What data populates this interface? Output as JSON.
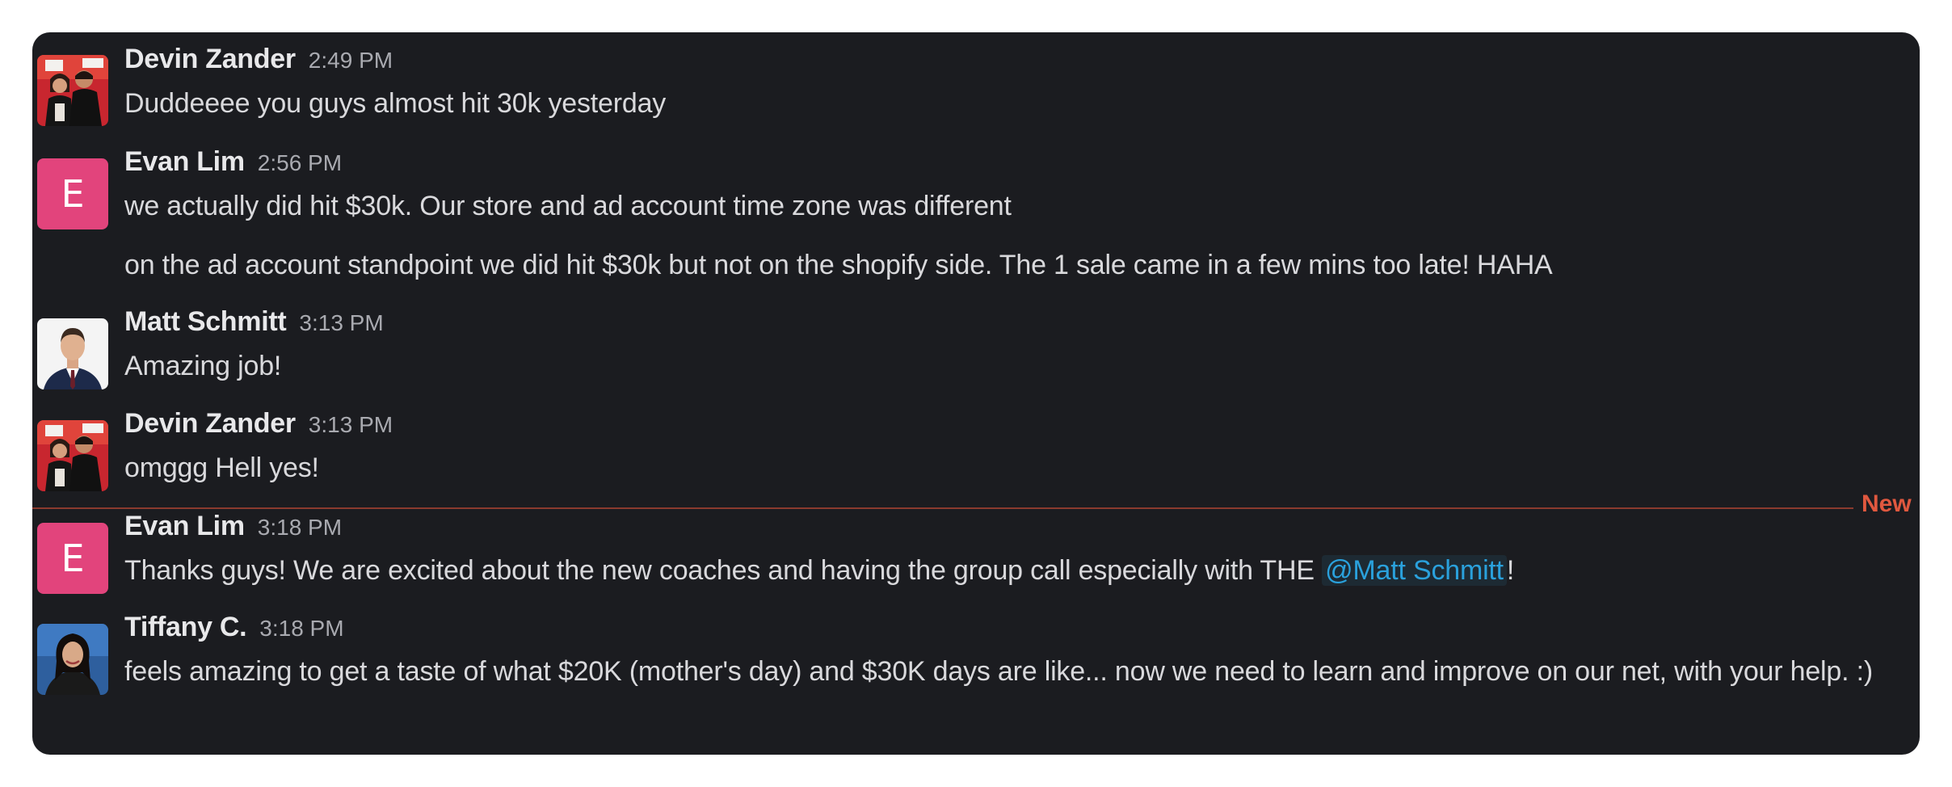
{
  "divider": {
    "label": "New"
  },
  "messages": [
    {
      "author": "Devin Zander",
      "time": "2:49 PM",
      "avatar": {
        "type": "photo",
        "icon": "couple-photo-avatar"
      },
      "lines": [
        "Duddeeee you guys almost hit 30k yesterday"
      ]
    },
    {
      "author": "Evan Lim",
      "time": "2:56 PM",
      "avatar": {
        "type": "letter",
        "letter": "E",
        "color": "#e2447c"
      },
      "lines": [
        "we actually did hit $30k. Our store and ad account time zone was different",
        "on the ad account standpoint we did hit $30k but not on the shopify side. The 1 sale came in a few mins too late! HAHA"
      ]
    },
    {
      "author": "Matt Schmitt",
      "time": "3:13 PM",
      "avatar": {
        "type": "photo",
        "icon": "man-in-suit-avatar"
      },
      "lines": [
        "Amazing job!"
      ]
    },
    {
      "author": "Devin Zander",
      "time": "3:13 PM",
      "avatar": {
        "type": "photo",
        "icon": "couple-photo-avatar"
      },
      "lines": [
        "omggg Hell yes!"
      ]
    },
    {
      "author": "Evan Lim",
      "time": "3:18 PM",
      "avatar": {
        "type": "letter",
        "letter": "E",
        "color": "#e2447c"
      },
      "text_before": "Thanks guys! We are excited about the new coaches and having the group call especially with THE ",
      "mention": "@Matt Schmitt",
      "text_after": "!"
    },
    {
      "author": "Tiffany C.",
      "time": "3:18 PM",
      "avatar": {
        "type": "photo",
        "icon": "woman-portrait-avatar"
      },
      "lines": [
        "feels amazing to get a taste of what $20K (mother's day) and $30K days are like... now we need to learn and improve on our net, with your help. :)"
      ]
    }
  ],
  "colors": {
    "panel_bg": "#1b1c20",
    "author": "#e8e8ea",
    "timestamp": "#a9aab0",
    "body_text": "#d9d9dc",
    "mention": "#2aa1dc",
    "new_divider": "#e0583f"
  }
}
